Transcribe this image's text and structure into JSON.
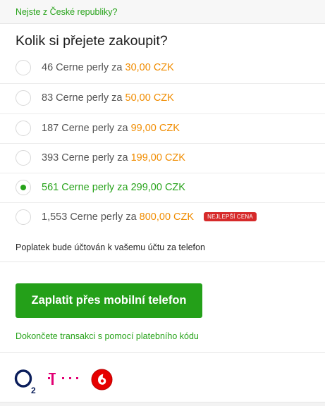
{
  "top": {
    "link_text": "Nejste z České republiky?"
  },
  "title": "Kolik si přejete zakoupit?",
  "options": [
    {
      "amount": "46",
      "unit": "Cerne perly",
      "connector": "za",
      "price": "30,00 CZK",
      "selected": false,
      "badge": ""
    },
    {
      "amount": "83",
      "unit": "Cerne perly",
      "connector": "za",
      "price": "50,00 CZK",
      "selected": false,
      "badge": ""
    },
    {
      "amount": "187",
      "unit": "Cerne perly",
      "connector": "za",
      "price": "99,00 CZK",
      "selected": false,
      "badge": ""
    },
    {
      "amount": "393",
      "unit": "Cerne perly",
      "connector": "za",
      "price": "199,00 CZK",
      "selected": false,
      "badge": ""
    },
    {
      "amount": "561",
      "unit": "Cerne perly",
      "connector": "za",
      "price": "299,00 CZK",
      "selected": true,
      "badge": ""
    },
    {
      "amount": "1,553",
      "unit": "Cerne perly",
      "connector": "za",
      "price": "800,00 CZK",
      "selected": false,
      "badge": "NEJLEPŠÍ CENA"
    }
  ],
  "fee_note": "Poplatek bude účtován k vašemu účtu za telefon",
  "pay_button": "Zaplatit přes mobilní telefon",
  "code_link": "Dokončete transakci s pomocí platebního kódu",
  "logos": [
    {
      "name": "o2-logo",
      "text": "O2"
    },
    {
      "name": "t-mobile-logo",
      "text": "T··"
    },
    {
      "name": "vodafone-logo",
      "text": ""
    }
  ],
  "colors": {
    "accent_green": "#27a31a",
    "button_green": "#24a019",
    "price_orange": "#f08c00",
    "badge_red": "#d62a2a",
    "o2_blue": "#0b1e5b",
    "telekom_magenta": "#e20074",
    "vodafone_red": "#e60000"
  }
}
